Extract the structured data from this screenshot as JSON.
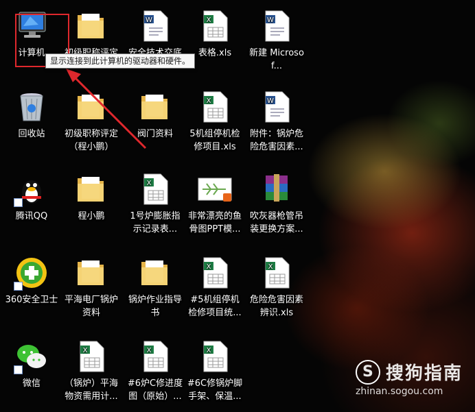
{
  "desktop": {
    "icons": [
      {
        "label": "计算机",
        "icon": "computer-icon"
      },
      {
        "label": "初级职称评定",
        "icon": "folder-icon"
      },
      {
        "label": "安全技术交底",
        "icon": "word-document-icon"
      },
      {
        "label": "表格.xls",
        "icon": "excel-document-icon"
      },
      {
        "label": "新建 Microsof...",
        "icon": "word-document-icon"
      },
      {
        "label": "回收站",
        "icon": "recycle-bin-icon"
      },
      {
        "label": "初级职称评定（程小鹏）",
        "icon": "folder-icon"
      },
      {
        "label": "阀门资料",
        "icon": "folder-icon"
      },
      {
        "label": "5机组停机检修项目.xls",
        "icon": "excel-document-icon"
      },
      {
        "label": "附件：锅炉危险危害因素...",
        "icon": "word-document-icon"
      },
      {
        "label": "腾讯QQ",
        "icon": "qq-penguin-icon"
      },
      {
        "label": "程小鹏",
        "icon": "folder-icon"
      },
      {
        "label": "1号炉膨胀指示记录表...",
        "icon": "excel-document-icon"
      },
      {
        "label": "非常漂亮的鱼骨图PPT模...",
        "icon": "ppt-thumbnail-icon"
      },
      {
        "label": "吹灰器枪管吊装更换方案...",
        "icon": "winrar-archive-icon"
      },
      {
        "label": "360安全卫士",
        "icon": "360-security-icon"
      },
      {
        "label": "平海电厂锅炉资料",
        "icon": "folder-icon"
      },
      {
        "label": "锅炉作业指导书",
        "icon": "folder-icon"
      },
      {
        "label": "#5机组停机检修项目统...",
        "icon": "excel-document-icon"
      },
      {
        "label": "危险危害因素辨识.xls",
        "icon": "excel-document-icon"
      },
      {
        "label": "微信",
        "icon": "wechat-icon"
      },
      {
        "label": "（锅炉）平海物资需用计...",
        "icon": "excel-document-icon"
      },
      {
        "label": "#6炉C修进度图（原始）...",
        "icon": "excel-document-icon"
      },
      {
        "label": "#6C修锅炉脚手架、保温...",
        "icon": "excel-document-icon"
      }
    ]
  },
  "tooltip": {
    "text": "显示连接到此计算机的驱动器和硬件。"
  },
  "watermark": {
    "brand": "搜狗指南",
    "url": "zhinan.sogou.com"
  },
  "colors": {
    "annotation_red": "#e0282d",
    "excel_green": "#1e7e45",
    "word_blue": "#2b5797",
    "folder_yellow": "#f1c85a"
  }
}
